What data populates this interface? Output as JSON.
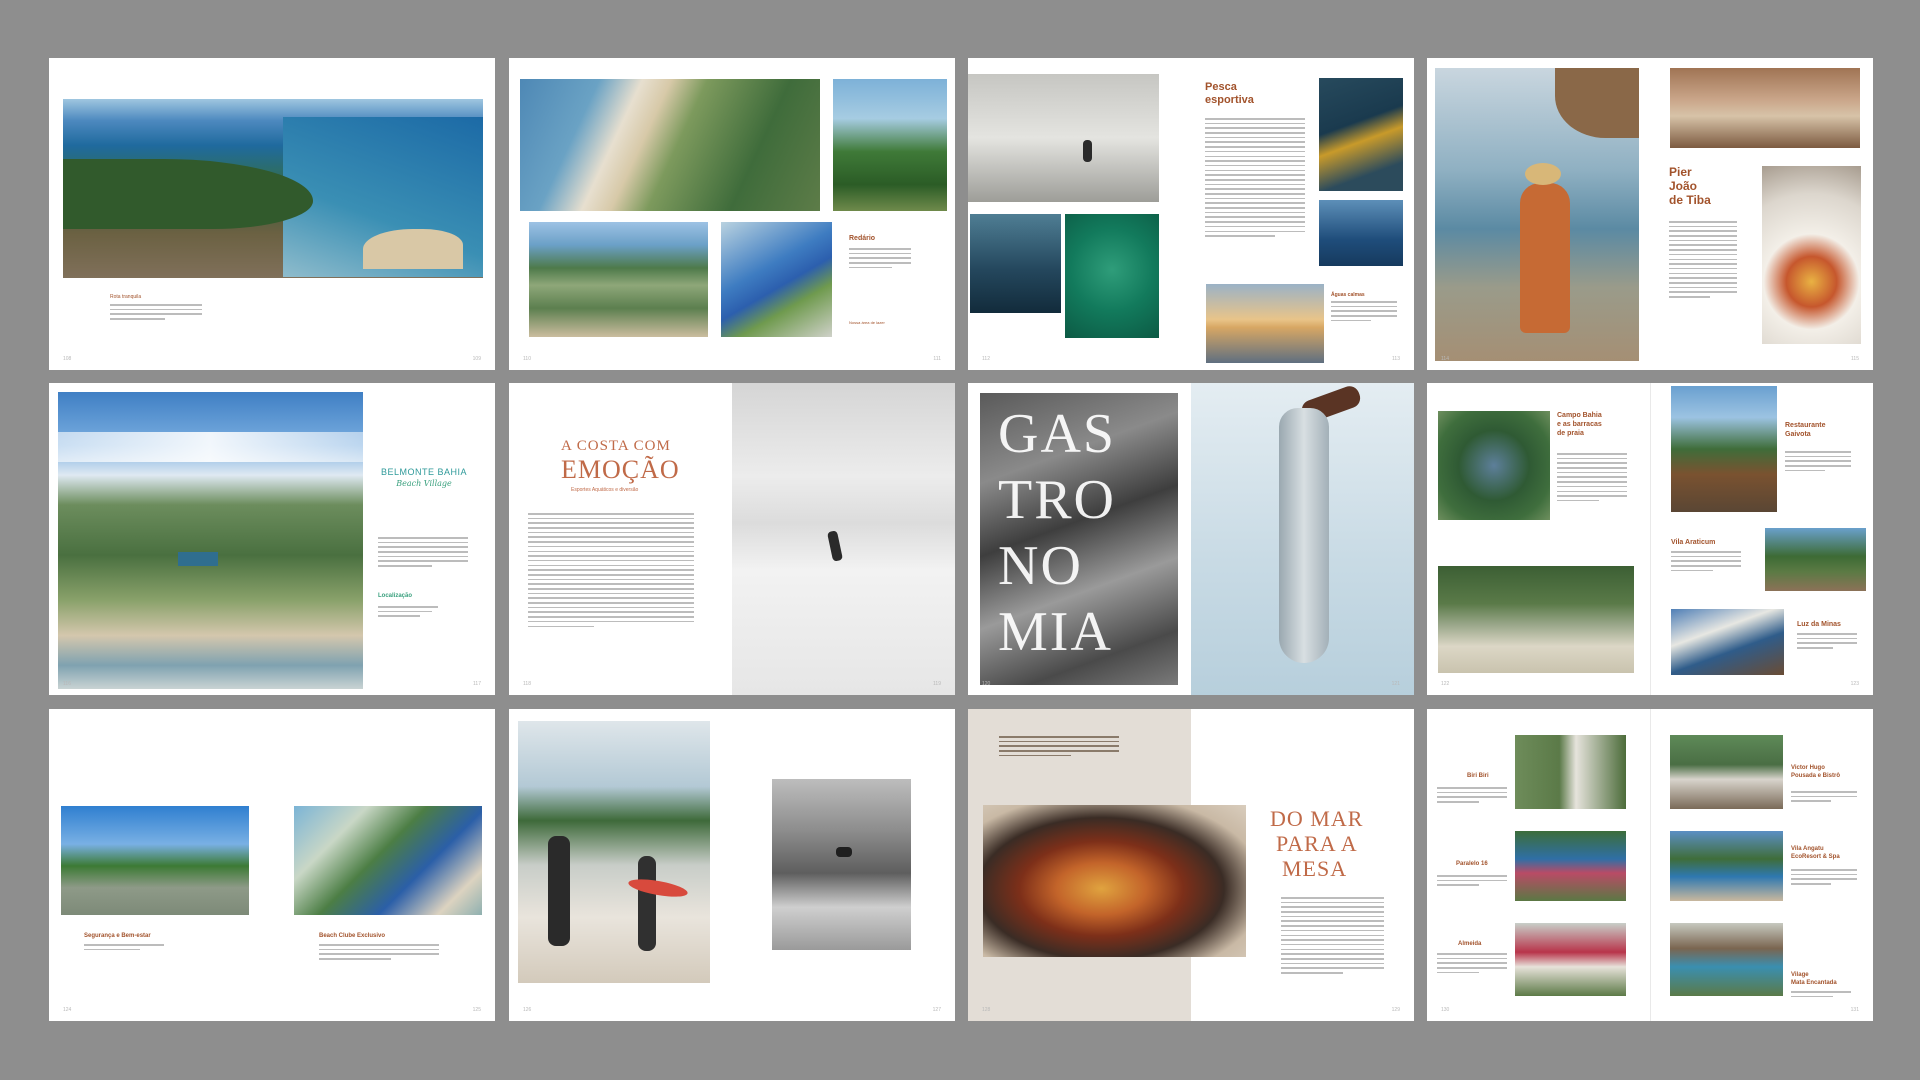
{
  "spreads": {
    "s1": {
      "caption_heading": "Rota tranquila"
    },
    "s2": {
      "caption_heading": "Redário",
      "footer_note": "Nossa área de lazer"
    },
    "s3": {
      "title": "Pesca\nesportiva",
      "caption_heading": "Águas calmas"
    },
    "s4": {
      "title": "Pier\nJoão\nde Tiba"
    },
    "s5": {
      "logo_main": "BELMONTE BAHIA",
      "logo_script": "Beach Village",
      "section_heading": "Localização"
    },
    "s6": {
      "title_line1": "A COSTA COM",
      "title_line2": "EMOÇÃO",
      "subtitle": "Esportes Aquáticos e diversão"
    },
    "s7": {
      "poster_lines": [
        "GAS",
        "TRO",
        "NO",
        "MIA"
      ]
    },
    "s8": {
      "item1": "Campo Bahia\ne as barracas\nde praia",
      "item2": "Restaurante\nGaivota",
      "item3": "Vila Araticum",
      "item4": "Luz da Minas"
    },
    "s9": {
      "caption_left": "Segurança e Bem-estar",
      "caption_right": "Beach Clube Exclusivo"
    },
    "s11": {
      "title_line1": "DO MAR",
      "title_line2": "PARA A",
      "title_line3": "MESA"
    },
    "s12": {
      "left_items": [
        "Biri Biri",
        "Paralelo 16",
        "Almeida"
      ],
      "right_items": [
        "Victor Hugo\nPousada e Bistrô",
        "Vila Angatu\nEcoResort & Spa",
        "Vilage\nMata Encantada"
      ]
    },
    "colors": {
      "background": "#8e8e8e",
      "page": "#ffffff",
      "accent": "#a2532c",
      "teal": "#2f9a9a"
    }
  }
}
